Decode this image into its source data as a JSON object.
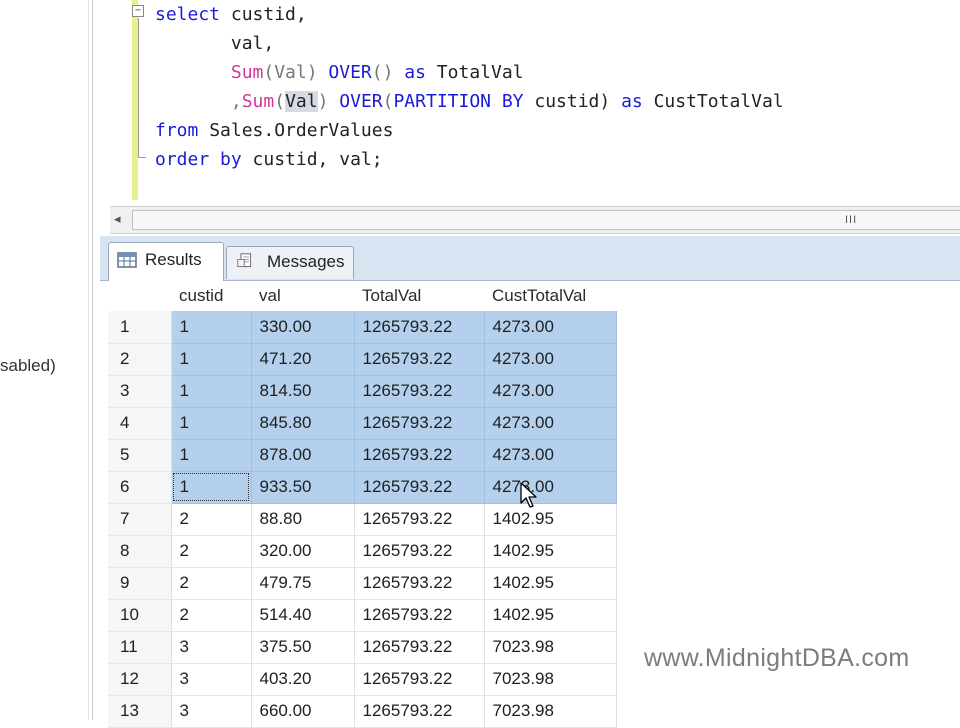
{
  "left_pane": {
    "partial_label": "sabled)"
  },
  "editor": {
    "fold_symbol": "−",
    "lines": [
      [
        {
          "t": "select",
          "c": "kw"
        },
        {
          "t": " custid,",
          "c": ""
        }
      ],
      [
        {
          "t": "       val,",
          "c": ""
        }
      ],
      [
        {
          "t": "       ",
          "c": ""
        },
        {
          "t": "Sum",
          "c": "fn"
        },
        {
          "t": "(Val) ",
          "c": "gr"
        },
        {
          "t": "OVER",
          "c": "kw"
        },
        {
          "t": "() ",
          "c": "gr"
        },
        {
          "t": "as",
          "c": "kw"
        },
        {
          "t": " TotalVal",
          "c": ""
        }
      ],
      [
        {
          "t": "       ,",
          "c": "gr"
        },
        {
          "t": "Sum",
          "c": "fn"
        },
        {
          "t": "(",
          "c": "gr"
        },
        {
          "t": "Val",
          "c": "hl"
        },
        {
          "t": ") ",
          "c": "gr"
        },
        {
          "t": "OVER",
          "c": "kw"
        },
        {
          "t": "(",
          "c": "gr"
        },
        {
          "t": "PARTITION BY",
          "c": "kw"
        },
        {
          "t": " custid) ",
          "c": ""
        },
        {
          "t": "as",
          "c": "kw"
        },
        {
          "t": " CustTotalVal",
          "c": ""
        }
      ],
      [
        {
          "t": "from",
          "c": "kw"
        },
        {
          "t": " Sales.OrderValues",
          "c": ""
        }
      ],
      [
        {
          "t": "order by",
          "c": "kw"
        },
        {
          "t": " custid, val;",
          "c": ""
        }
      ]
    ]
  },
  "scrollbar": {
    "left_arrow": "◂",
    "grip": "III"
  },
  "tabs": [
    {
      "label": "Results",
      "icon": "grid-icon"
    },
    {
      "label": "Messages",
      "icon": "messages-icon"
    }
  ],
  "grid": {
    "columns": [
      "",
      "custid",
      "val",
      "TotalVal",
      "CustTotalVal"
    ],
    "rows": [
      [
        "1",
        "1",
        "330.00",
        "1265793.22",
        "4273.00"
      ],
      [
        "2",
        "1",
        "471.20",
        "1265793.22",
        "4273.00"
      ],
      [
        "3",
        "1",
        "814.50",
        "1265793.22",
        "4273.00"
      ],
      [
        "4",
        "1",
        "845.80",
        "1265793.22",
        "4273.00"
      ],
      [
        "5",
        "1",
        "878.00",
        "1265793.22",
        "4273.00"
      ],
      [
        "6",
        "1",
        "933.50",
        "1265793.22",
        "4273.00"
      ],
      [
        "7",
        "2",
        "88.80",
        "1265793.22",
        "1402.95"
      ],
      [
        "8",
        "2",
        "320.00",
        "1265793.22",
        "1402.95"
      ],
      [
        "9",
        "2",
        "479.75",
        "1265793.22",
        "1402.95"
      ],
      [
        "10",
        "2",
        "514.40",
        "1265793.22",
        "1402.95"
      ],
      [
        "11",
        "3",
        "375.50",
        "1265793.22",
        "7023.98"
      ],
      [
        "12",
        "3",
        "403.20",
        "1265793.22",
        "7023.98"
      ],
      [
        "13",
        "3",
        "660.00",
        "1265793.22",
        "7023.98"
      ]
    ],
    "selected_rows": [
      0,
      1,
      2,
      3,
      4,
      5
    ]
  },
  "colors": {
    "keyword": "#1b1bd8",
    "function": "#d1379a",
    "selection": "#b5d0ec",
    "tab_strip": "#d9e4f2"
  },
  "watermark": "www.MidnightDBA.com"
}
